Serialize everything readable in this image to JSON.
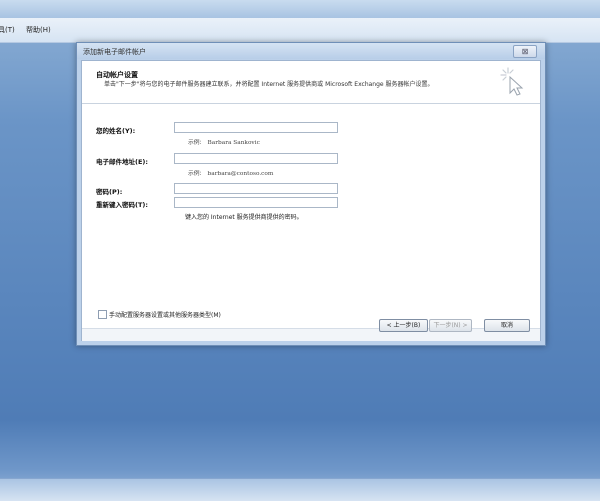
{
  "menubar": {
    "items": [
      {
        "label": "具(T)"
      },
      {
        "label": "帮助(H)"
      }
    ]
  },
  "dialog": {
    "title": "添加新电子邮件帐户",
    "close_glyph": "⊠",
    "header": {
      "title": "自动帐户设置",
      "description": "单击\"下一步\"将与您的电子邮件服务器建立联系，并将配置 Internet 服务提供商或 Microsoft Exchange 服务器帐户设置。"
    },
    "fields": {
      "name": {
        "label": "您的姓名(Y):",
        "value": "",
        "example_prefix": "示例:",
        "example_value": "Barbara Sankovic"
      },
      "email": {
        "label": "电子邮件地址(E):",
        "value": "",
        "example_prefix": "示例:",
        "example_value": "barbara@contoso.com"
      },
      "password": {
        "label": "密码(P):",
        "value": ""
      },
      "password_retype": {
        "label": "重新键入密码(T):",
        "value": ""
      },
      "password_hint": "键入您的 Internet 服务提供商提供的密码。"
    },
    "manual_setup": {
      "label": "手动配置服务器设置或其他服务器类型(M)",
      "checked": false
    },
    "buttons": {
      "back": "< 上一步(B)",
      "next": "下一步(N) >",
      "cancel": "取消"
    }
  }
}
